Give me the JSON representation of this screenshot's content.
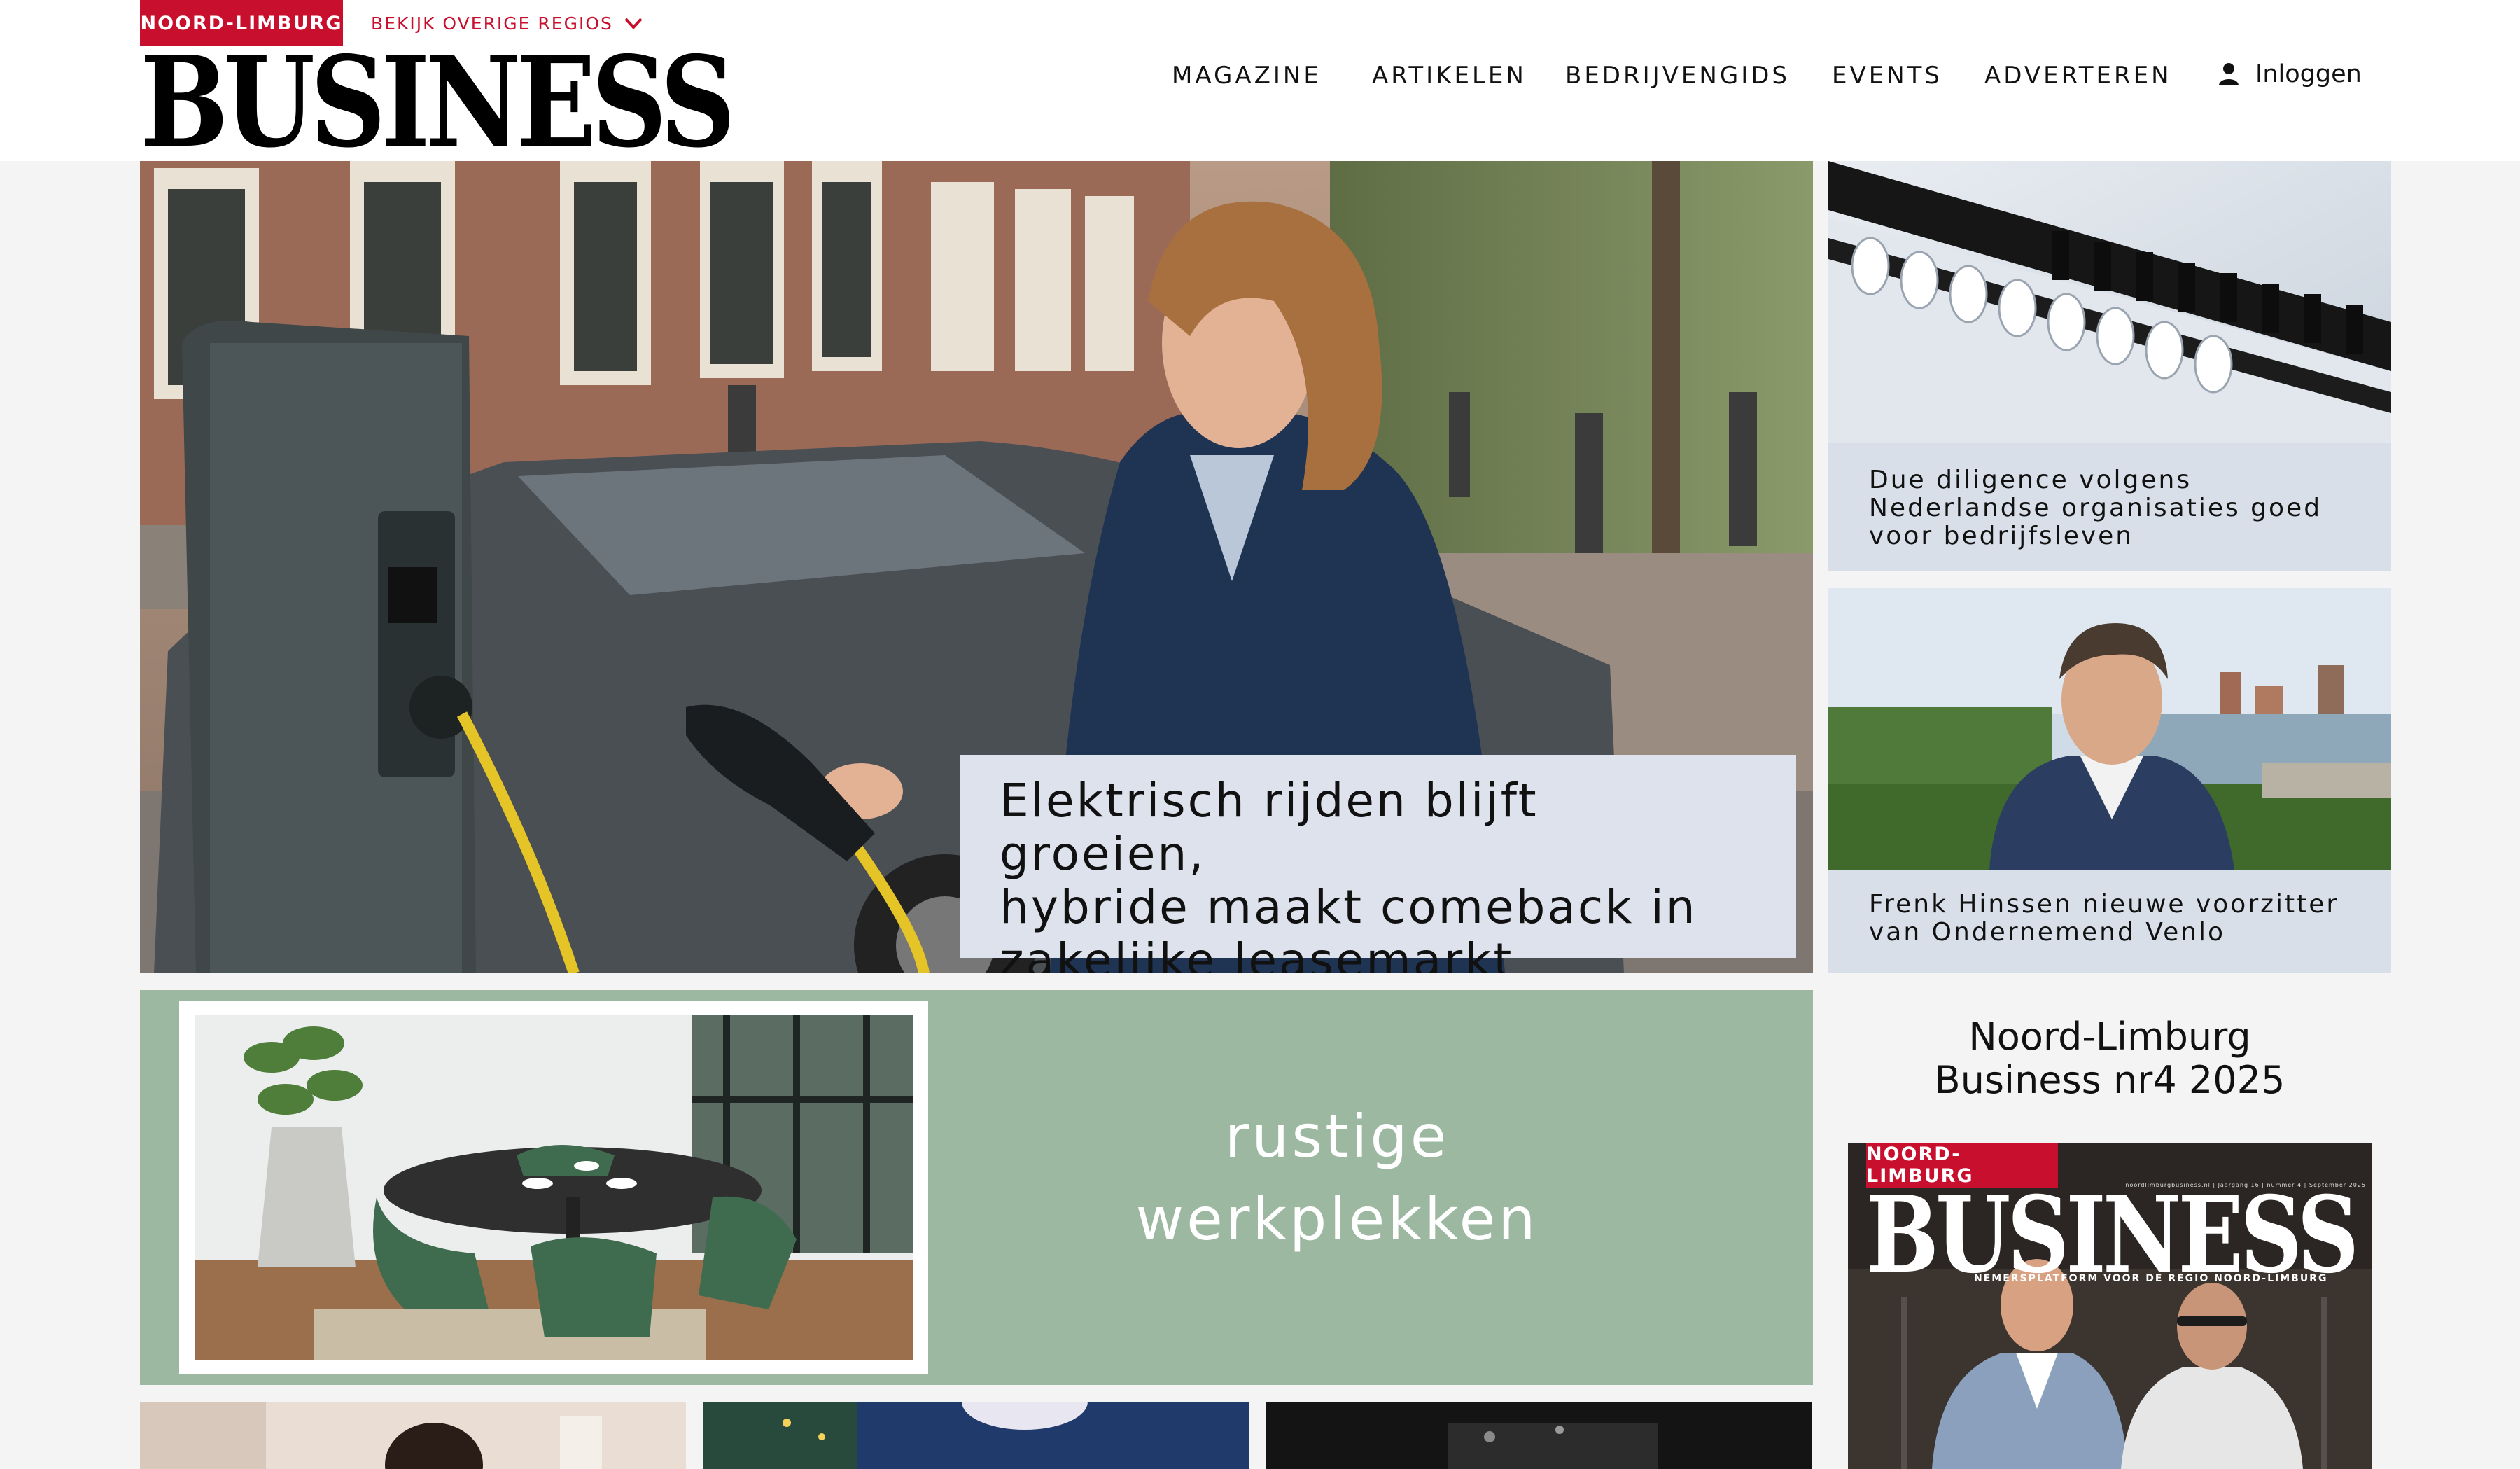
{
  "header": {
    "region_badge": "NOORD-LIMBURG",
    "region_link": "BEKIJK OVERIGE REGIOS",
    "logo": "BUSINESS",
    "nav": [
      "MAGAZINE",
      "ARTIKELEN",
      "BEDRIJVENGIDS",
      "EVENTS",
      "ADVERTEREN"
    ],
    "login_label": "Inloggen"
  },
  "hero": {
    "caption_lines": [
      "Elektrisch rijden blijft groeien,",
      "hybride maakt comeback in",
      "zakelijke leasemarkt"
    ]
  },
  "side_articles": [
    {
      "caption_lines": [
        "Due diligence volgens",
        "Nederlandse organisaties goed",
        "voor bedrijfsleven"
      ]
    },
    {
      "caption_lines": [
        "Frenk Hinssen nieuwe voorzitter",
        "van Ondernemend Venlo"
      ]
    }
  ],
  "ad": {
    "text_lines": [
      "rustige",
      "werkplekken"
    ]
  },
  "magazine": {
    "title_lines": [
      "Noord-Limburg",
      "Business nr4 2025"
    ],
    "cover_badge": "NOORD-LIMBURG",
    "cover_logo": "BUSINESS",
    "cover_small": "noordlimburgbusiness.nl | Jaargang 16 | nummer 4 | September 2025",
    "cover_tagline": "NEMERSPLATFORM VOOR DE REGIO NOORD-LIMBURG"
  },
  "colors": {
    "brand_red": "#c8102e",
    "caption_bg": "#dde2ec",
    "ad_green": "#9db8a0"
  }
}
